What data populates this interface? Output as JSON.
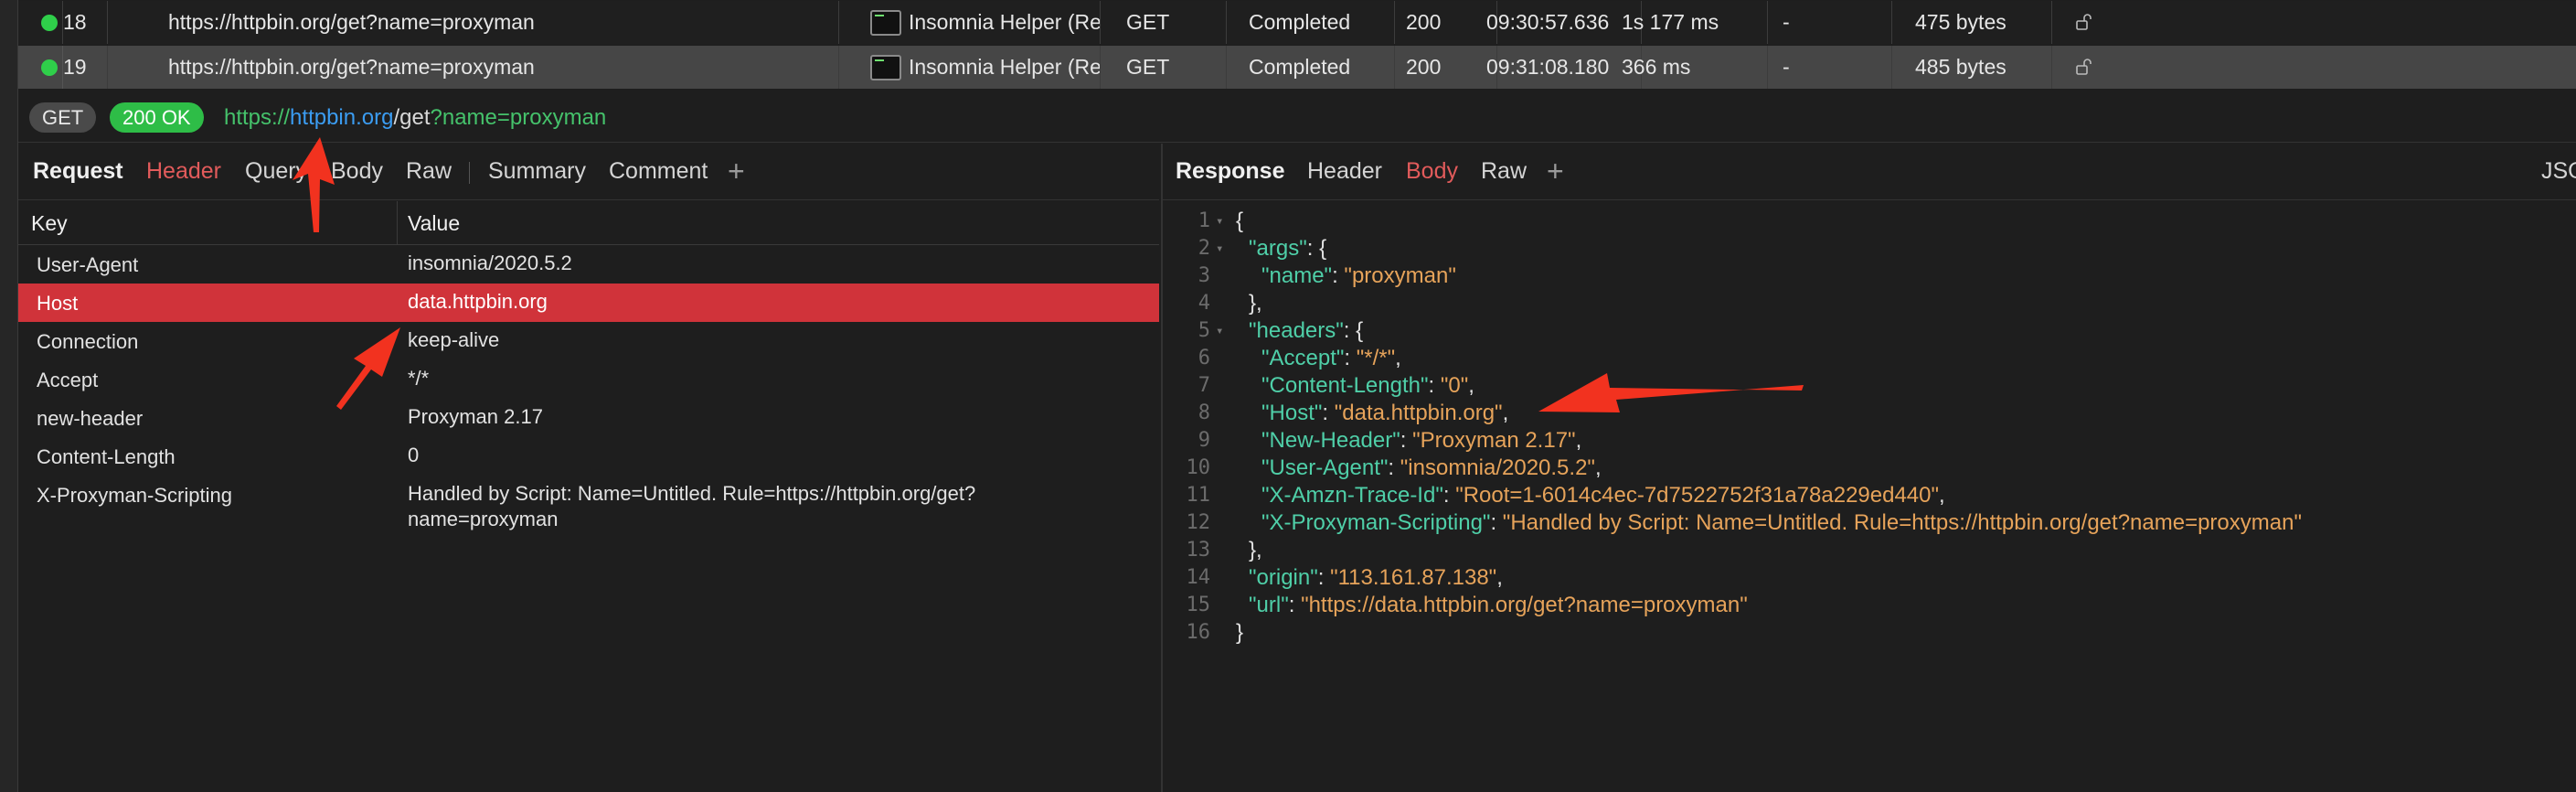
{
  "flows": [
    {
      "id": "18",
      "url": "https://httpbin.org/get?name=proxyman",
      "client": "Insomnia Helper (Re...",
      "method": "GET",
      "status": "Completed",
      "code": "200",
      "time": "09:30:57.636",
      "duration": "1s 177 ms",
      "request_size": "-",
      "response_size": "475 bytes"
    },
    {
      "id": "19",
      "url": "https://httpbin.org/get?name=proxyman",
      "client": "Insomnia Helper (Re...",
      "method": "GET",
      "status": "Completed",
      "code": "200",
      "time": "09:31:08.180",
      "duration": "366 ms",
      "request_size": "-",
      "response_size": "485 bytes"
    }
  ],
  "url_bar": {
    "method": "GET",
    "status": "200 OK",
    "scheme": "https://",
    "host": "httpbin.org",
    "path": "/get",
    "query": "?name=proxyman"
  },
  "request": {
    "title": "Request",
    "tabs": [
      "Header",
      "Query",
      "Body",
      "Raw",
      "Summary",
      "Comment"
    ],
    "active_tab": "Header",
    "columns": {
      "key": "Key",
      "value": "Value"
    },
    "headers": [
      {
        "key": "User-Agent",
        "value": "insomnia/2020.5.2"
      },
      {
        "key": "Host",
        "value": "data.httpbin.org"
      },
      {
        "key": "Connection",
        "value": "keep-alive"
      },
      {
        "key": "Accept",
        "value": "*/*"
      },
      {
        "key": "new-header",
        "value": "Proxyman 2.17"
      },
      {
        "key": "Content-Length",
        "value": "0"
      },
      {
        "key": "X-Proxyman-Scripting",
        "value": "Handled by Script: Name=Untitled. Rule=https://httpbin.org/get?name=proxyman"
      }
    ],
    "selected_header": "Host"
  },
  "response": {
    "title": "Response",
    "tabs": [
      "Header",
      "Body",
      "Raw"
    ],
    "active_tab": "Body",
    "format": "JSO",
    "lines": [
      {
        "n": "1",
        "indent": 0,
        "parts": [
          [
            "p",
            "{"
          ]
        ]
      },
      {
        "n": "2",
        "indent": 1,
        "parts": [
          [
            "k",
            "\"args\""
          ],
          [
            "p",
            ": {"
          ]
        ]
      },
      {
        "n": "3",
        "indent": 2,
        "parts": [
          [
            "k",
            "\"name\""
          ],
          [
            "p",
            ": "
          ],
          [
            "s",
            "\"proxyman\""
          ]
        ]
      },
      {
        "n": "4",
        "indent": 1,
        "parts": [
          [
            "p",
            "},"
          ]
        ]
      },
      {
        "n": "5",
        "indent": 1,
        "parts": [
          [
            "k",
            "\"headers\""
          ],
          [
            "p",
            ": {"
          ]
        ]
      },
      {
        "n": "6",
        "indent": 2,
        "parts": [
          [
            "k",
            "\"Accept\""
          ],
          [
            "p",
            ": "
          ],
          [
            "s",
            "\"*/*\""
          ],
          [
            "p",
            ","
          ]
        ]
      },
      {
        "n": "7",
        "indent": 2,
        "parts": [
          [
            "k",
            "\"Content-Length\""
          ],
          [
            "p",
            ": "
          ],
          [
            "s",
            "\"0\""
          ],
          [
            "p",
            ","
          ]
        ]
      },
      {
        "n": "8",
        "indent": 2,
        "parts": [
          [
            "k",
            "\"Host\""
          ],
          [
            "p",
            ": "
          ],
          [
            "s",
            "\"data.httpbin.org\""
          ],
          [
            "p",
            ","
          ]
        ]
      },
      {
        "n": "9",
        "indent": 2,
        "parts": [
          [
            "k",
            "\"New-Header\""
          ],
          [
            "p",
            ": "
          ],
          [
            "s",
            "\"Proxyman 2.17\""
          ],
          [
            "p",
            ","
          ]
        ]
      },
      {
        "n": "10",
        "indent": 2,
        "parts": [
          [
            "k",
            "\"User-Agent\""
          ],
          [
            "p",
            ": "
          ],
          [
            "s",
            "\"insomnia/2020.5.2\""
          ],
          [
            "p",
            ","
          ]
        ]
      },
      {
        "n": "11",
        "indent": 2,
        "parts": [
          [
            "k",
            "\"X-Amzn-Trace-Id\""
          ],
          [
            "p",
            ": "
          ],
          [
            "s",
            "\"Root=1-6014c4ec-7d7522752f31a78a229ed440\""
          ],
          [
            "p",
            ","
          ]
        ]
      },
      {
        "n": "12",
        "indent": 2,
        "parts": [
          [
            "k",
            "\"X-Proxyman-Scripting\""
          ],
          [
            "p",
            ": "
          ],
          [
            "s",
            "\"Handled by Script: Name=Untitled. Rule=https://httpbin.org/get?name=proxyman\""
          ]
        ]
      },
      {
        "n": "13",
        "indent": 1,
        "parts": [
          [
            "p",
            "},"
          ]
        ]
      },
      {
        "n": "14",
        "indent": 1,
        "parts": [
          [
            "k",
            "\"origin\""
          ],
          [
            "p",
            ": "
          ],
          [
            "s",
            "\"113.161.87.138\""
          ],
          [
            "p",
            ","
          ]
        ]
      },
      {
        "n": "15",
        "indent": 1,
        "parts": [
          [
            "k",
            "\"url\""
          ],
          [
            "p",
            ": "
          ],
          [
            "s",
            "\"https://data.httpbin.org/get?name=proxyman\""
          ]
        ]
      },
      {
        "n": "16",
        "indent": 0,
        "parts": [
          [
            "p",
            "}"
          ]
        ]
      }
    ],
    "foldable_lines": [
      "1",
      "2",
      "5"
    ]
  },
  "icons": {
    "status_dot": "status-dot-icon",
    "app": "terminal-app-icon",
    "lock": "unlocked-icon",
    "plus": "plus-icon"
  },
  "colors": {
    "status_ok": "#2ebd47",
    "active_tab": "#e25b5b",
    "selected_row": "#d0333a",
    "json_key": "#4fcfa8",
    "json_string": "#e6a35a",
    "url_host": "#3b9cf1",
    "arrow": "#f2321f"
  }
}
